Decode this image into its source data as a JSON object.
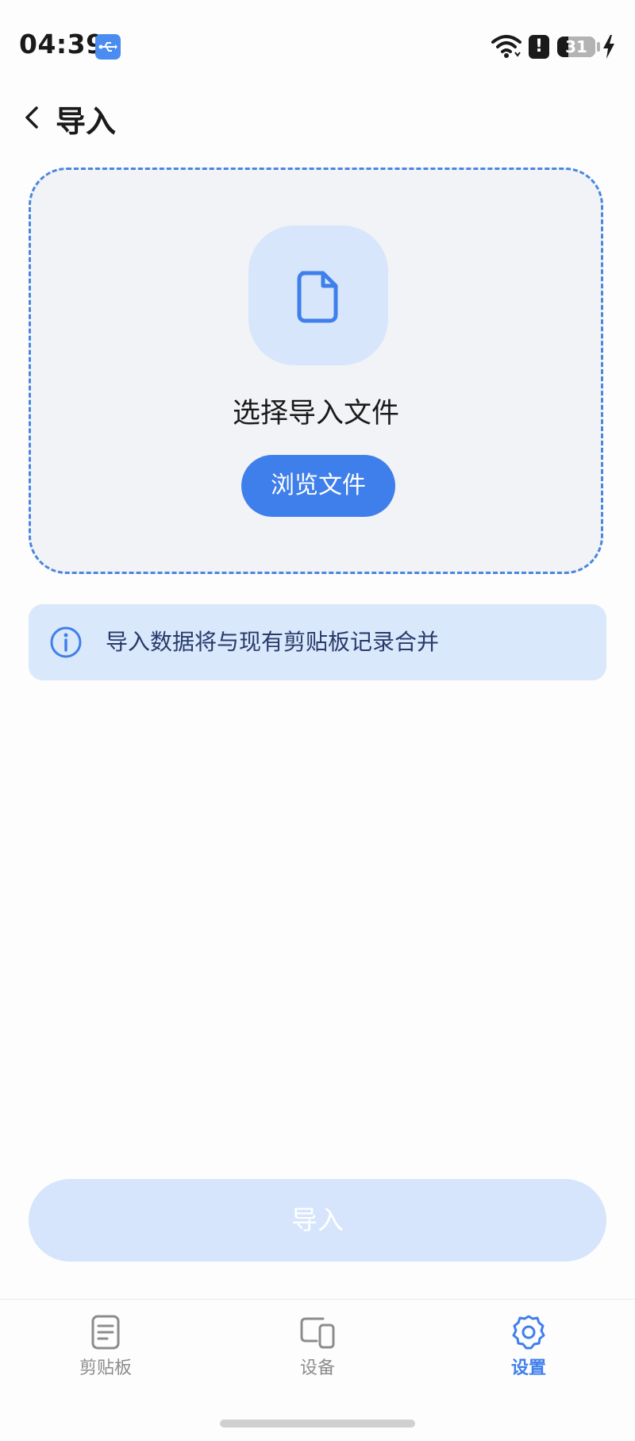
{
  "status_bar": {
    "time": "04:39",
    "battery_level": "31",
    "icons": [
      "usb-icon",
      "wifi-icon",
      "alert-icon",
      "battery-icon",
      "charging-bolt-icon"
    ]
  },
  "header": {
    "back_icon": "chevron-left-icon",
    "title": "导入"
  },
  "drop_zone": {
    "icon": "file-icon",
    "title": "选择导入文件",
    "browse_label": "浏览文件"
  },
  "info": {
    "icon": "info-icon",
    "text": "导入数据将与现有剪贴板记录合并"
  },
  "import_button": {
    "label": "导入",
    "enabled": false
  },
  "tab_bar": {
    "tabs": [
      {
        "label": "剪贴板",
        "icon": "clipboard-icon",
        "active": false
      },
      {
        "label": "设备",
        "icon": "devices-icon",
        "active": false
      },
      {
        "label": "设置",
        "icon": "gear-icon",
        "active": true
      }
    ]
  },
  "colors": {
    "accent": "#3f7feb",
    "accent_light": "#d7e6fb",
    "dashed_border": "#4a86e0",
    "info_text": "#283a6a",
    "disabled_button": "#d6e5fb"
  }
}
